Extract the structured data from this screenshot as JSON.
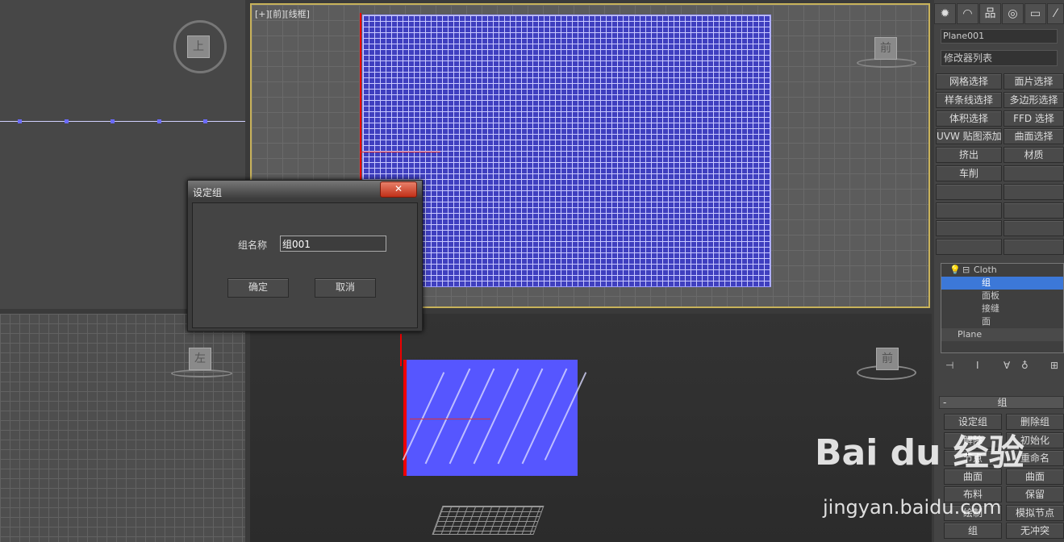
{
  "viewports": {
    "front_label": "[+][前][线框]",
    "top_cube": "上",
    "front_cube": "前",
    "left_cube": "左",
    "persp_cube": "前"
  },
  "dialog": {
    "title": "设定组",
    "close_glyph": "✕",
    "name_label": "组名称",
    "name_value": "组001",
    "ok_label": "确定",
    "cancel_label": "取消"
  },
  "panel": {
    "tabs": [
      "✹",
      "◠",
      "品",
      "◎",
      "▭",
      "⁄"
    ],
    "object_name": "Plane001",
    "modifier_list": "修改器列表",
    "buttons": [
      [
        "网格选择",
        "面片选择"
      ],
      [
        "样条线选择",
        "多边形选择"
      ],
      [
        "体积选择",
        "FFD 选择"
      ],
      [
        "UVW 贴图添加",
        "曲面选择"
      ],
      [
        "挤出",
        "材质"
      ],
      [
        "车削",
        ""
      ],
      [
        "",
        ""
      ],
      [
        "",
        ""
      ],
      [
        "",
        ""
      ],
      [
        "",
        ""
      ]
    ],
    "stack": {
      "root": "Cloth",
      "items": [
        "组",
        "面板",
        "接缝",
        "面"
      ],
      "base": "Plane"
    },
    "stack_tools": [
      "⊣",
      "Ⅰ",
      "∀",
      "♁",
      "⊞"
    ],
    "rollout": {
      "toggle": "-",
      "title": "组"
    },
    "group_buttons": [
      [
        "设定组",
        "删除组"
      ],
      [
        "解除",
        "初始化"
      ],
      [
        "节点",
        "重命名"
      ],
      [
        "曲面",
        "曲面"
      ],
      [
        "布料",
        "保留"
      ],
      [
        "绘制",
        "模拟节点"
      ],
      [
        "组",
        "无冲突"
      ]
    ]
  },
  "watermark": {
    "logo": "Bai du 经验",
    "url": "jingyan.baidu.com"
  }
}
